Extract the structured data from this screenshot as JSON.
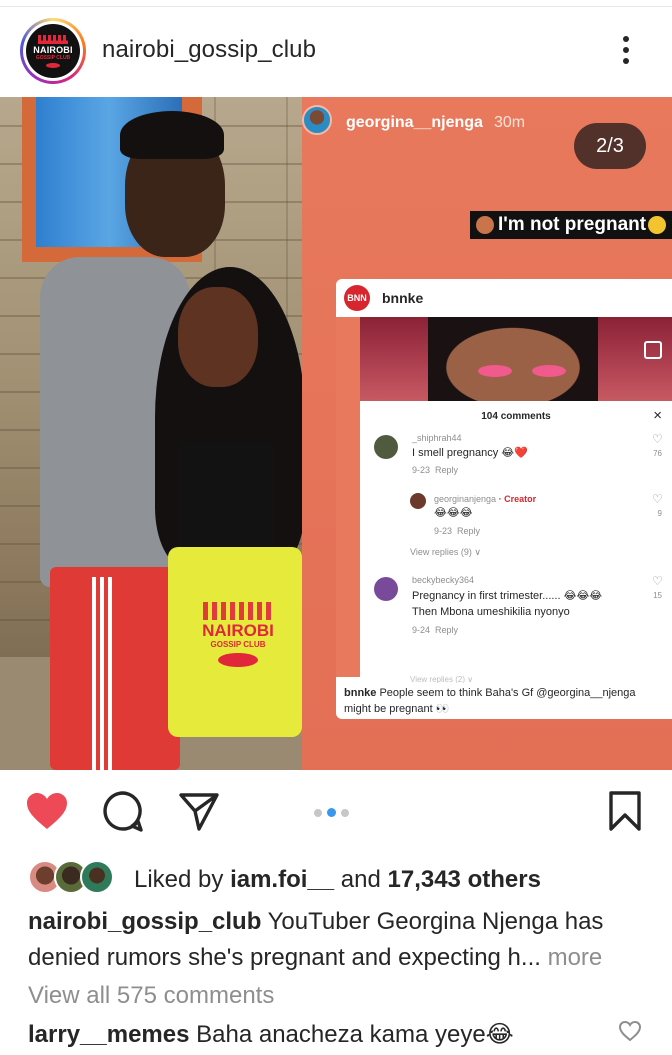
{
  "header": {
    "username": "nairobi_gossip_club",
    "avatar_logo_line1": "NAIROBI",
    "avatar_logo_line2": "GOSSIP CLUB"
  },
  "media": {
    "watermark_title": "NAIROBI",
    "watermark_sub": "GOSSIP CLUB",
    "story": {
      "username": "georgina__njenga",
      "time": "30m",
      "counter": "2/3",
      "sticker_text": "I'm not pregnant"
    },
    "embedded_post": {
      "logo": "BNN",
      "username": "bnnke",
      "comments_title": "104 comments",
      "close": "×",
      "comments": [
        {
          "user": "_shiphrah44",
          "text": "I smell pregnancy 😂❤️",
          "date": "9-23",
          "reply": "Reply",
          "likes": "76"
        },
        {
          "user": "georginanjenga",
          "badge": "· Creator",
          "text": "😂😂😂",
          "date": "9-23",
          "reply": "Reply",
          "likes": "9"
        },
        {
          "view_replies": "View replies (9) ∨"
        },
        {
          "user": "beckybecky364",
          "text": "Pregnancy in first trimester...... 😂😂😂",
          "text2": "Then Mbona umeshikilia nyonyo",
          "date": "9-24",
          "reply": "Reply",
          "likes": "15"
        }
      ],
      "cut_text": "View replies (2) ∨",
      "caption_user": "bnnke",
      "caption_text": "People seem to think Baha's Gf @georgina__njenga might be pregnant 👀"
    }
  },
  "actions": {
    "like_icon": "heart-filled-icon",
    "comment_icon": "comment-icon",
    "share_icon": "paper-plane-icon",
    "save_icon": "bookmark-icon",
    "carousel_total": 3,
    "carousel_active": 2,
    "colors": {
      "like": "#ed4956",
      "dot_active": "#3897f0",
      "dot_inactive": "#c7c7c7"
    }
  },
  "likes": {
    "prefix": "Liked by ",
    "user": "iam.foi__",
    "middle": " and ",
    "others": "17,343 others"
  },
  "caption": {
    "user": "nairobi_gossip_club",
    "text": " YouTuber Georgina Njenga has denied rumors she's pregnant and expecting h...",
    "more": " more"
  },
  "view_all_comments": "View all 575 comments",
  "last_comment": {
    "user": "larry__memes",
    "text": " Baha anacheza kama yeye😂"
  }
}
